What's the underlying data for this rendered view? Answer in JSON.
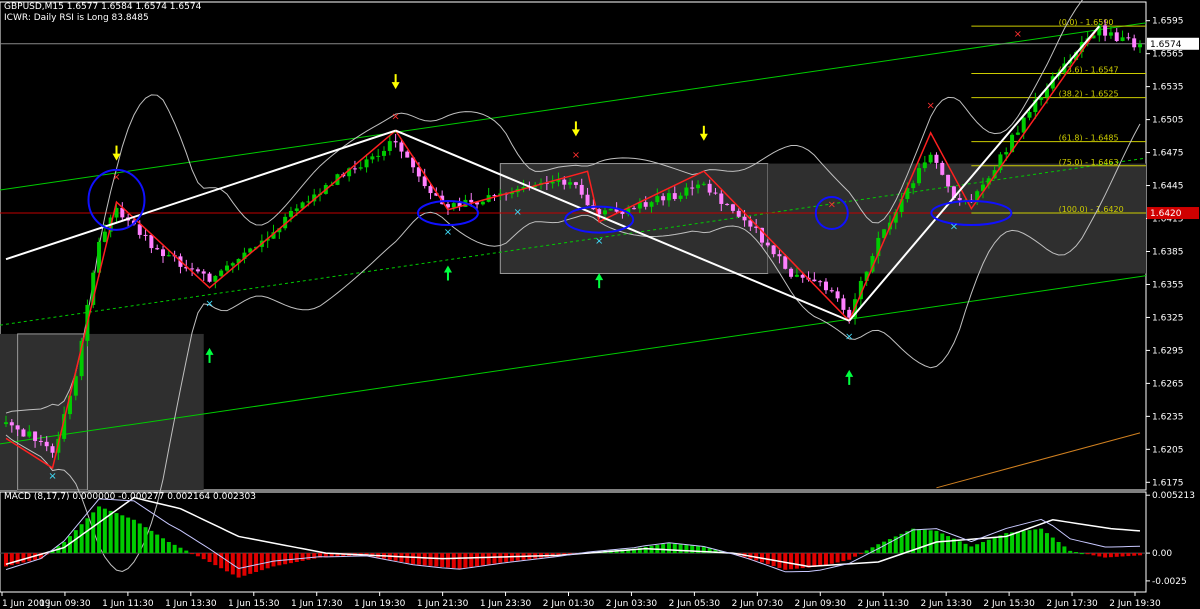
{
  "header": {
    "symbol_line": "GBPUSD,M15  1.6577 1.6584 1.6574 1.6574",
    "indicator_line": "ICWR: Daily RSI is Long 83.8485"
  },
  "macd_header": "MACD  (8,17,7) 0.000000 -0.000277 0.002164 0.002303",
  "chart_data": [
    {
      "type": "candlestick",
      "title": "GBPUSD,M15",
      "price_axis_labels": [
        "1.6595",
        "1.6565",
        "1.6535",
        "1.6505",
        "1.6475",
        "1.6445",
        "1.6415",
        "1.6385",
        "1.6355",
        "1.6325",
        "1.6295",
        "1.6265",
        "1.6235",
        "1.6205",
        "1.6175"
      ],
      "ylim": [
        1.6168,
        1.6612
      ],
      "current_price_label": "1.6574",
      "current_price": 1.6574,
      "level_marker_label": "1.6420",
      "level_marker": 1.642,
      "time_labels": [
        "1 Jun 2009",
        "1 Jun 09:30",
        "1 Jun 11:30",
        "1 Jun 13:30",
        "1 Jun 15:30",
        "1 Jun 17:30",
        "1 Jun 19:30",
        "1 Jun 21:30",
        "1 Jun 23:30",
        "2 Jun 01:30",
        "2 Jun 03:30",
        "2 Jun 05:30",
        "2 Jun 07:30",
        "2 Jun 09:30",
        "2 Jun 11:30",
        "2 Jun 13:30",
        "2 Jun 15:30",
        "2 Jun 17:30",
        "2 Jun 19:30"
      ],
      "fibonacci_levels": [
        {
          "label": "(0.0) - 1.6590",
          "price": 1.659
        },
        {
          "label": "(23.6) - 1.6547",
          "price": 1.6547
        },
        {
          "label": "(38.2) - 1.6525",
          "price": 1.6525
        },
        {
          "label": "(61.8) - 1.6485",
          "price": 1.6485
        },
        {
          "label": "(75.0) - 1.6463",
          "price": 1.6463
        },
        {
          "label": "(100.0) - 1.6420",
          "price": 1.642
        }
      ],
      "zigzag_pivots": [
        {
          "bar": 0,
          "price": 1.6215
        },
        {
          "bar": 8,
          "price": 1.6188
        },
        {
          "bar": 19,
          "price": 1.643
        },
        {
          "bar": 35,
          "price": 1.6352
        },
        {
          "bar": 67,
          "price": 1.6495
        },
        {
          "bar": 76,
          "price": 1.6423
        },
        {
          "bar": 98,
          "price": 1.6455
        },
        {
          "bar": 100,
          "price": 1.6458
        },
        {
          "bar": 102,
          "price": 1.6412
        },
        {
          "bar": 120,
          "price": 1.6458
        },
        {
          "bar": 145,
          "price": 1.6322
        },
        {
          "bar": 159,
          "price": 1.6493
        },
        {
          "bar": 166,
          "price": 1.6424
        },
        {
          "bar": 188,
          "price": 1.659
        }
      ],
      "close_path_pivots": [
        {
          "bar": 0,
          "price": 1.6228
        },
        {
          "bar": 6,
          "price": 1.6212
        },
        {
          "bar": 8,
          "price": 1.6198
        },
        {
          "bar": 12,
          "price": 1.627
        },
        {
          "bar": 16,
          "price": 1.6395
        },
        {
          "bar": 19,
          "price": 1.6425
        },
        {
          "bar": 26,
          "price": 1.6385
        },
        {
          "bar": 35,
          "price": 1.636
        },
        {
          "bar": 45,
          "price": 1.64
        },
        {
          "bar": 55,
          "price": 1.6445
        },
        {
          "bar": 64,
          "price": 1.6475
        },
        {
          "bar": 67,
          "price": 1.6488
        },
        {
          "bar": 72,
          "price": 1.6445
        },
        {
          "bar": 76,
          "price": 1.6425
        },
        {
          "bar": 84,
          "price": 1.6435
        },
        {
          "bar": 92,
          "price": 1.6445
        },
        {
          "bar": 98,
          "price": 1.6448
        },
        {
          "bar": 100,
          "price": 1.643
        },
        {
          "bar": 102,
          "price": 1.6418
        },
        {
          "bar": 110,
          "price": 1.6428
        },
        {
          "bar": 120,
          "price": 1.6445
        },
        {
          "bar": 127,
          "price": 1.6415
        },
        {
          "bar": 135,
          "price": 1.6365
        },
        {
          "bar": 140,
          "price": 1.636
        },
        {
          "bar": 145,
          "price": 1.6328
        },
        {
          "bar": 150,
          "price": 1.6395
        },
        {
          "bar": 156,
          "price": 1.645
        },
        {
          "bar": 159,
          "price": 1.6475
        },
        {
          "bar": 163,
          "price": 1.6435
        },
        {
          "bar": 166,
          "price": 1.6428
        },
        {
          "bar": 175,
          "price": 1.6505
        },
        {
          "bar": 182,
          "price": 1.6555
        },
        {
          "bar": 186,
          "price": 1.658
        },
        {
          "bar": 188,
          "price": 1.6588
        },
        {
          "bar": 192,
          "price": 1.6576
        },
        {
          "bar": 195,
          "price": 1.6574
        }
      ],
      "bars": 196,
      "colors": {
        "bull": "#00cc00",
        "bear": "#ff80ff",
        "zigzag": "#ff2020",
        "channel": "#00cc00",
        "bands": "#c0c0c0",
        "trend": "#ffffff",
        "fib": "#cccc00",
        "rectangle": "#9a9a9a",
        "h_level": "#c00000"
      }
    },
    {
      "type": "histogram",
      "title": "MACD",
      "params": "(8,17,7)",
      "axis_labels": [
        "0.005213",
        "0.00",
        "-0.0025"
      ],
      "ylim": [
        -0.0035,
        0.0055
      ],
      "bull_color": "#00cc00",
      "bear_color": "#e00000",
      "line_color": "#ffffff",
      "histogram_pivots": [
        {
          "bar": 0,
          "value": -0.0012
        },
        {
          "bar": 6,
          "value": -0.0005
        },
        {
          "bar": 10,
          "value": 0.001
        },
        {
          "bar": 16,
          "value": 0.0042
        },
        {
          "bar": 22,
          "value": 0.003
        },
        {
          "bar": 28,
          "value": 0.001
        },
        {
          "bar": 35,
          "value": -0.0008
        },
        {
          "bar": 40,
          "value": -0.0022
        },
        {
          "bar": 46,
          "value": -0.0012
        },
        {
          "bar": 54,
          "value": -0.0004
        },
        {
          "bar": 62,
          "value": -0.0002
        },
        {
          "bar": 70,
          "value": -0.001
        },
        {
          "bar": 78,
          "value": -0.0014
        },
        {
          "bar": 86,
          "value": -0.0008
        },
        {
          "bar": 94,
          "value": -0.0003
        },
        {
          "bar": 100,
          "value": 0.0001
        },
        {
          "bar": 108,
          "value": 0.0004
        },
        {
          "bar": 114,
          "value": 0.0009
        },
        {
          "bar": 120,
          "value": 0.0006
        },
        {
          "bar": 128,
          "value": -0.0005
        },
        {
          "bar": 134,
          "value": -0.0015
        },
        {
          "bar": 140,
          "value": -0.0012
        },
        {
          "bar": 145,
          "value": -0.0006
        },
        {
          "bar": 150,
          "value": 0.0008
        },
        {
          "bar": 156,
          "value": 0.0022
        },
        {
          "bar": 160,
          "value": 0.002
        },
        {
          "bar": 166,
          "value": 0.0006
        },
        {
          "bar": 172,
          "value": 0.0018
        },
        {
          "bar": 178,
          "value": 0.0022
        },
        {
          "bar": 183,
          "value": 0.0002
        },
        {
          "bar": 189,
          "value": -0.0004
        },
        {
          "bar": 195,
          "value": -0.0002
        }
      ],
      "signal_pivots": [
        {
          "bar": 0,
          "value": -0.001
        },
        {
          "bar": 10,
          "value": 0.0005
        },
        {
          "bar": 22,
          "value": 0.005
        },
        {
          "bar": 30,
          "value": 0.004
        },
        {
          "bar": 40,
          "value": 0.0015
        },
        {
          "bar": 55,
          "value": 0.0
        },
        {
          "bar": 75,
          "value": -0.0005
        },
        {
          "bar": 95,
          "value": -0.0002
        },
        {
          "bar": 110,
          "value": 0.0004
        },
        {
          "bar": 125,
          "value": 0.0
        },
        {
          "bar": 138,
          "value": -0.0012
        },
        {
          "bar": 150,
          "value": -0.0008
        },
        {
          "bar": 160,
          "value": 0.001
        },
        {
          "bar": 172,
          "value": 0.0015
        },
        {
          "bar": 180,
          "value": 0.003
        },
        {
          "bar": 190,
          "value": 0.0022
        },
        {
          "bar": 195,
          "value": 0.002
        }
      ]
    }
  ]
}
